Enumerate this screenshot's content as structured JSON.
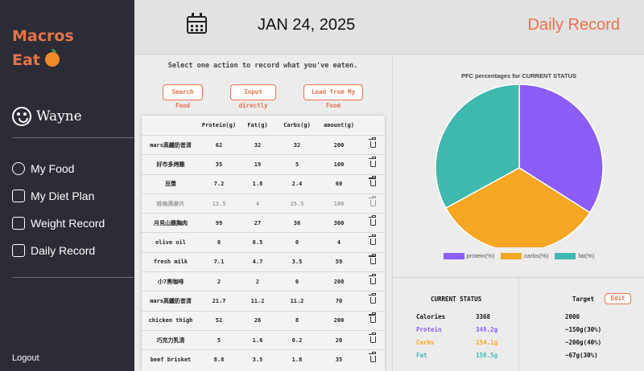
{
  "sidebar": {
    "logo_line1": "Macros",
    "logo_line2": "Eat",
    "logo_icon": "orange-icon",
    "user_name": "Wayne",
    "nav": [
      {
        "label": "My Food",
        "icon": "apple-icon"
      },
      {
        "label": "My Diet Plan",
        "icon": "edit-icon"
      },
      {
        "label": "Weight Record",
        "icon": "scale-icon"
      },
      {
        "label": "Daily Record",
        "icon": "newspaper-icon"
      }
    ],
    "logout": "Logout"
  },
  "header": {
    "date": "JAN 24, 2025",
    "title": "Daily Record",
    "calendar_icon": "calendar-icon"
  },
  "actions": {
    "instruction": "Select one action to record what you've eaten.",
    "search_food": "Search Food",
    "input_directly": "Input directly",
    "load_from_my_food": "Load from My Food"
  },
  "table": {
    "headers": [
      "",
      "Protein(g)",
      "Fat(g)",
      "Carbs(g)",
      "amount(g)",
      ""
    ],
    "rows": [
      {
        "name": "mars高纖奶昔清",
        "protein": "62",
        "fat": "32",
        "carbs": "32",
        "amount": "200"
      },
      {
        "name": "好市多烤雞",
        "protein": "35",
        "fat": "19",
        "carbs": "5",
        "amount": "100"
      },
      {
        "name": "豆漿",
        "protein": "7.2",
        "fat": "1.8",
        "carbs": "2.4",
        "amount": "60"
      },
      {
        "name": "桂格燕麥片",
        "protein": "13.5",
        "fat": "4",
        "carbs": "25.5",
        "amount": "100"
      },
      {
        "name": "月見山雞胸肉",
        "protein": "99",
        "fat": "27",
        "carbs": "36",
        "amount": "300"
      },
      {
        "name": "olive oil",
        "protein": "0",
        "fat": "0.5",
        "carbs": "0",
        "amount": "4"
      },
      {
        "name": "fresh milk",
        "protein": "7.1",
        "fat": "4.7",
        "carbs": "3.5",
        "amount": "59"
      },
      {
        "name": "小7黑咖啡",
        "protein": "2",
        "fat": "2",
        "carbs": "0",
        "amount": "200"
      },
      {
        "name": "mars高纖奶昔清",
        "protein": "21.7",
        "fat": "11.2",
        "carbs": "11.2",
        "amount": "70"
      },
      {
        "name": "chicken thigh",
        "protein": "52",
        "fat": "26",
        "carbs": "8",
        "amount": "200"
      },
      {
        "name": "巧克力乳清",
        "protein": "5",
        "fat": "1.6",
        "carbs": "0.2",
        "amount": "20"
      },
      {
        "name": "beef brisket",
        "protein": "8.8",
        "fat": "3.5",
        "carbs": "1.8",
        "amount": "35"
      }
    ]
  },
  "chart_data": {
    "type": "pie",
    "title": "PFC percentages for CURRENT STATUS",
    "categories": [
      "protein(%)",
      "carbs(%)",
      "fat(%)"
    ],
    "values": [
      34,
      33,
      33
    ],
    "colors": [
      "#8b5cf6",
      "#f5a623",
      "#3fb8ad"
    ],
    "legend_position": "bottom"
  },
  "status": {
    "current_header": "CURRENT STATUS",
    "target_header": "Target",
    "edit_label": "Edit",
    "rows": [
      {
        "label": "Calories",
        "value": "3368",
        "target": "2000",
        "color": "#111111"
      },
      {
        "label": "Protein",
        "value": "349.2g",
        "target": "~150g(30%)",
        "color": "#8b5cf6"
      },
      {
        "label": "Carbs",
        "value": "154.1g",
        "target": "~200g(40%)",
        "color": "#f5a623"
      },
      {
        "label": "Fat",
        "value": "150.5g",
        "target": "~67g(30%)",
        "color": "#3fb8ad"
      }
    ]
  }
}
